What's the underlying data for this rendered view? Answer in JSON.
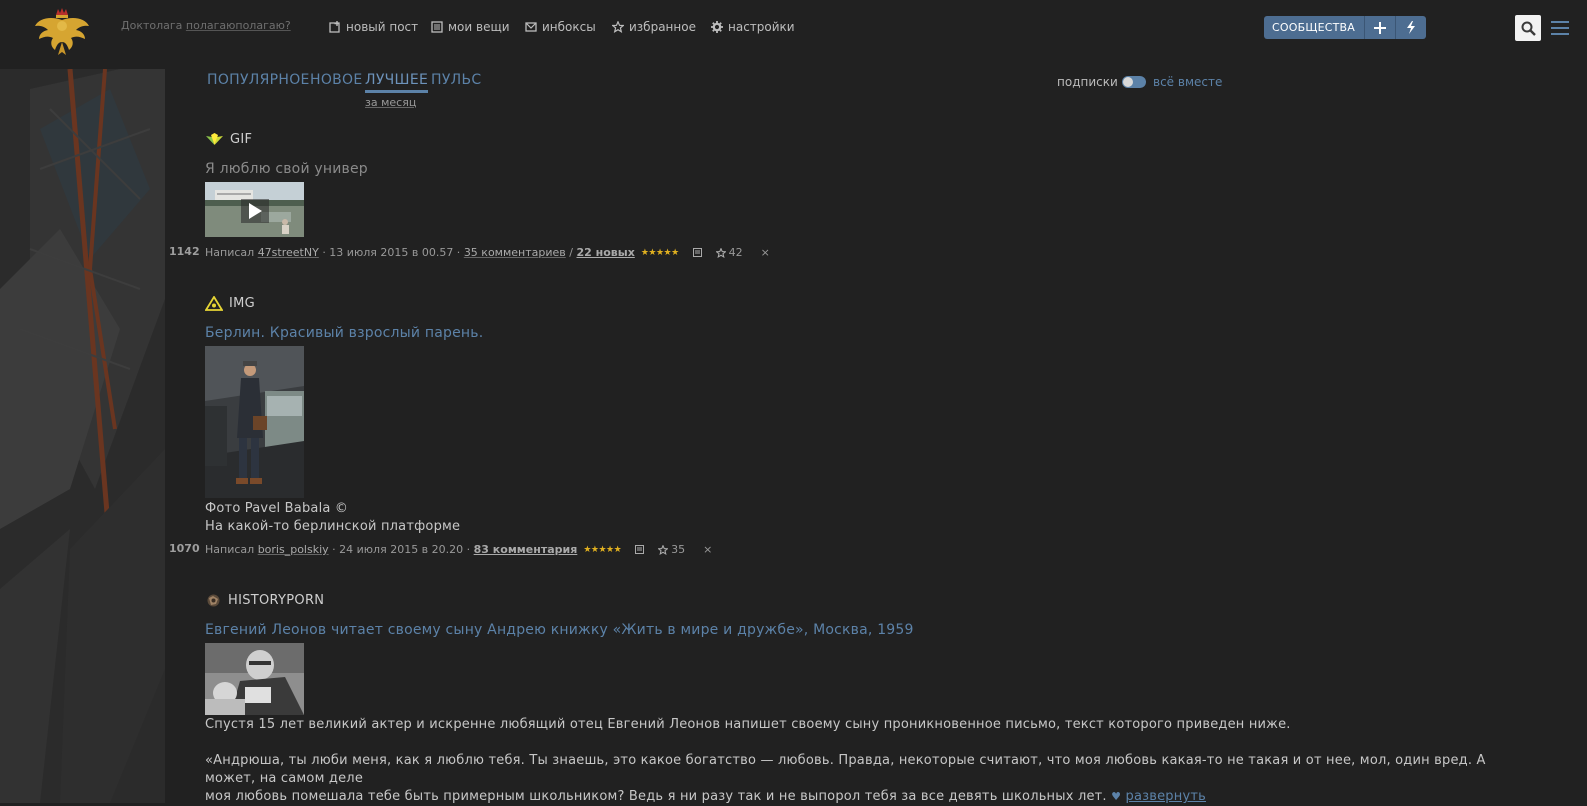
{
  "header": {
    "tagline_pre": "Доктолага ",
    "tagline_link": "полагаюполагаю?",
    "nav": [
      {
        "label": "новый пост",
        "icon": "new-post-icon"
      },
      {
        "label": "мои вещи",
        "icon": "my-stuff-icon"
      },
      {
        "label": "инбоксы",
        "icon": "inbox-icon"
      },
      {
        "label": "избранное",
        "icon": "star-icon"
      },
      {
        "label": "настройки",
        "icon": "gear-icon"
      }
    ],
    "communities_label": "СООБЩЕСТВА",
    "accent": "#4d6d91"
  },
  "tabs": {
    "popular": "ПОПУЛЯРНОЕ",
    "new": "НОВОЕ",
    "best": "ЛУЧШЕЕ",
    "pulse": "ПУЛЬС",
    "period": "за месяц",
    "subscriptions": "подписки",
    "all": "всё вместе"
  },
  "posts": [
    {
      "category": "GIF",
      "title": "Я люблю свой универ",
      "score": "1142",
      "meta": {
        "written": "Написал",
        "author": "47streetNY",
        "date": "· 13 июля 2015 в 00.57 ·",
        "comments": "35 комментариев",
        "sep": "/",
        "new": "22 новых",
        "stars": "★★★★★",
        "favs": "42"
      }
    },
    {
      "category": "IMG",
      "title": "Берлин. Красивый взрослый парень.",
      "caption_1": "Фото Pavel Babala ©",
      "caption_2": "На какой-то берлинской платформе",
      "score": "1070",
      "meta": {
        "written": "Написал",
        "author": "boris_polskiy",
        "date": "· 24 июля 2015 в 20.20 ·",
        "comments": "83 комментария",
        "stars": "★★★★★",
        "favs": "35"
      }
    },
    {
      "category": "HISTORYPORN",
      "title": "Евгений Леонов читает своему сыну Андрею книжку «Жить в мире и дружбе», Москва, 1959",
      "para_1": "Спустя 15 лет великий актер и искренне любящий отец Евгений Леонов напишет своему сыну проникновенное письмо, текст которого приведен ниже.",
      "para_2a": "«Андрюша, ты люби меня, как я люблю тебя. Ты знаешь, это какое богатство — любовь. Правда, некоторые считают, что моя любовь какая-то не такая и от нее, мол, один вред. А может, на самом деле",
      "para_2b": "моя любовь помешала тебе быть примерным школьником? Ведь я ни разу так и не выпорол тебя за все девять школьных лет.",
      "expand": "развернуть"
    }
  ]
}
